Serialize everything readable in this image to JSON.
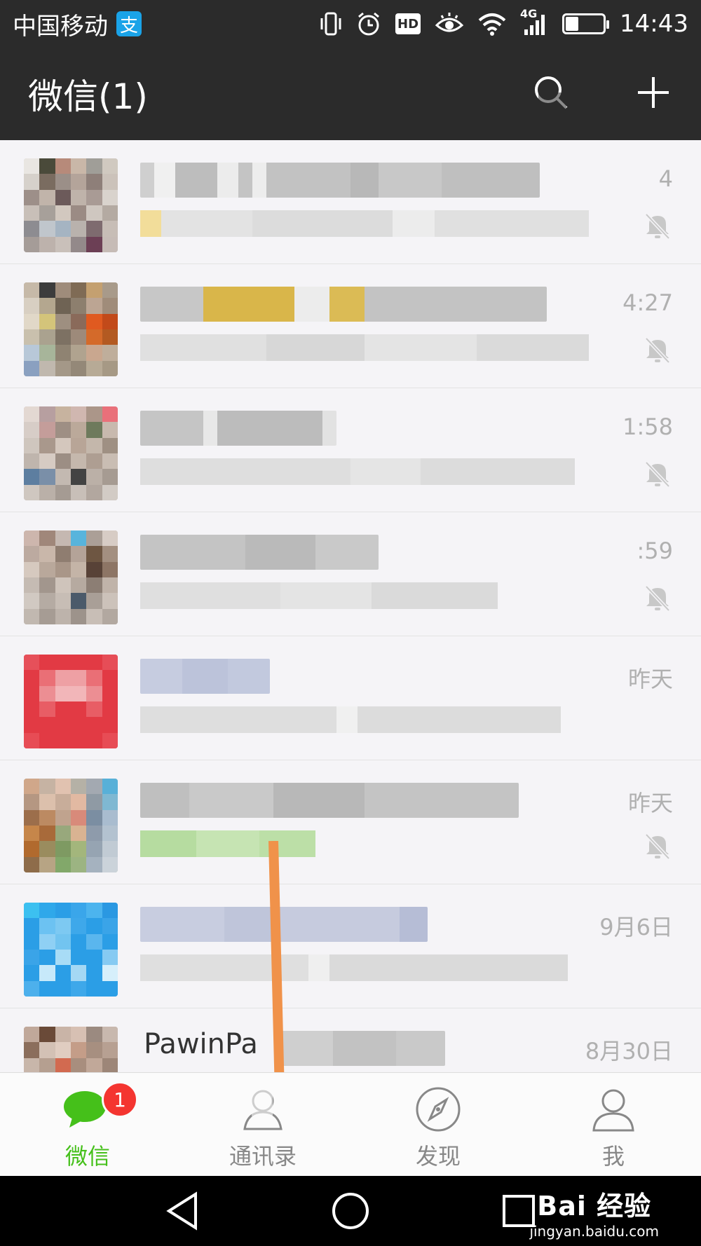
{
  "status_bar": {
    "carrier": "中国移动",
    "alipay_glyph": "支",
    "network": "4G",
    "hd": "HD",
    "time": "14:43"
  },
  "header": {
    "title": "微信(1)"
  },
  "chats": [
    {
      "time": "4",
      "muted": true
    },
    {
      "time": "4:27",
      "muted": true
    },
    {
      "time": "1:58",
      "muted": true
    },
    {
      "time": ":59",
      "muted": true
    },
    {
      "time": "昨天",
      "muted": false
    },
    {
      "time": "昨天",
      "muted": true
    },
    {
      "time": "9月6日",
      "muted": false
    },
    {
      "name": "PawinPa",
      "time": "8月30日",
      "muted": false
    }
  ],
  "tabs": [
    {
      "label": "微信",
      "badge": "1",
      "icon": "chat-bubbles-icon",
      "active": true
    },
    {
      "label": "通讯录",
      "icon": "contacts-icon",
      "active": false
    },
    {
      "label": "发现",
      "icon": "compass-icon",
      "active": false
    },
    {
      "label": "我",
      "icon": "person-icon",
      "active": false
    }
  ],
  "watermark": {
    "main": "Bai 经验",
    "sub": "jingyan.baidu.com"
  },
  "colors": {
    "header_bg": "#2b2b2b",
    "accent": "#45c01a",
    "badge": "#f43530",
    "annotation_arrow": "#f0924a"
  }
}
